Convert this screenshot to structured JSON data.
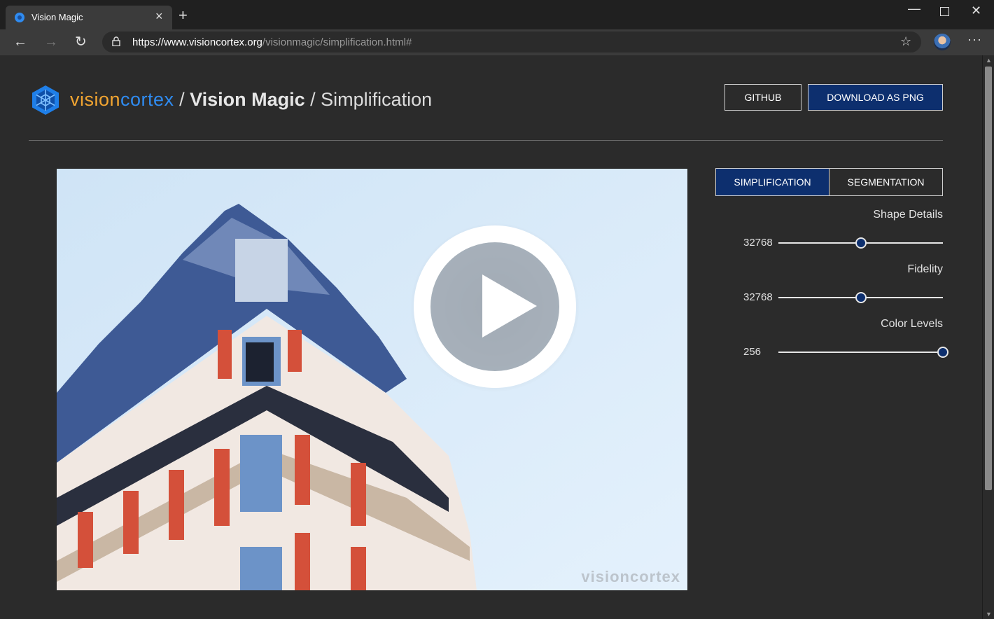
{
  "browser": {
    "tab_title": "Vision Magic",
    "url_main": "https://www.visioncortex.org",
    "url_path": "/visionmagic/simplification.html#"
  },
  "header": {
    "brand_vision": "vision",
    "brand_cortex": "cortex",
    "separator1": " / ",
    "app_name": "Vision Magic",
    "separator2": " / ",
    "page_name": "Simplification",
    "github_label": "GITHUB",
    "download_label": "DOWNLOAD AS PNG"
  },
  "preview": {
    "watermark": "visioncortex"
  },
  "modes": {
    "simplification": "SIMPLIFICATION",
    "segmentation": "SEGMENTATION",
    "active": "simplification"
  },
  "controls": {
    "shape_details": {
      "label": "Shape Details",
      "value": "32768",
      "fraction": 0.5
    },
    "fidelity": {
      "label": "Fidelity",
      "value": "32768",
      "fraction": 0.5
    },
    "color_levels": {
      "label": "Color Levels",
      "value": "256",
      "fraction": 1.0
    }
  },
  "colors": {
    "accent": "#0d2f6e",
    "brand_orange": "#f2a531",
    "brand_blue": "#2f8bf0"
  },
  "icons": [
    "back-icon",
    "forward-icon",
    "refresh-icon",
    "lock-icon",
    "star-icon",
    "more-icon",
    "play-icon",
    "logo-icon"
  ]
}
